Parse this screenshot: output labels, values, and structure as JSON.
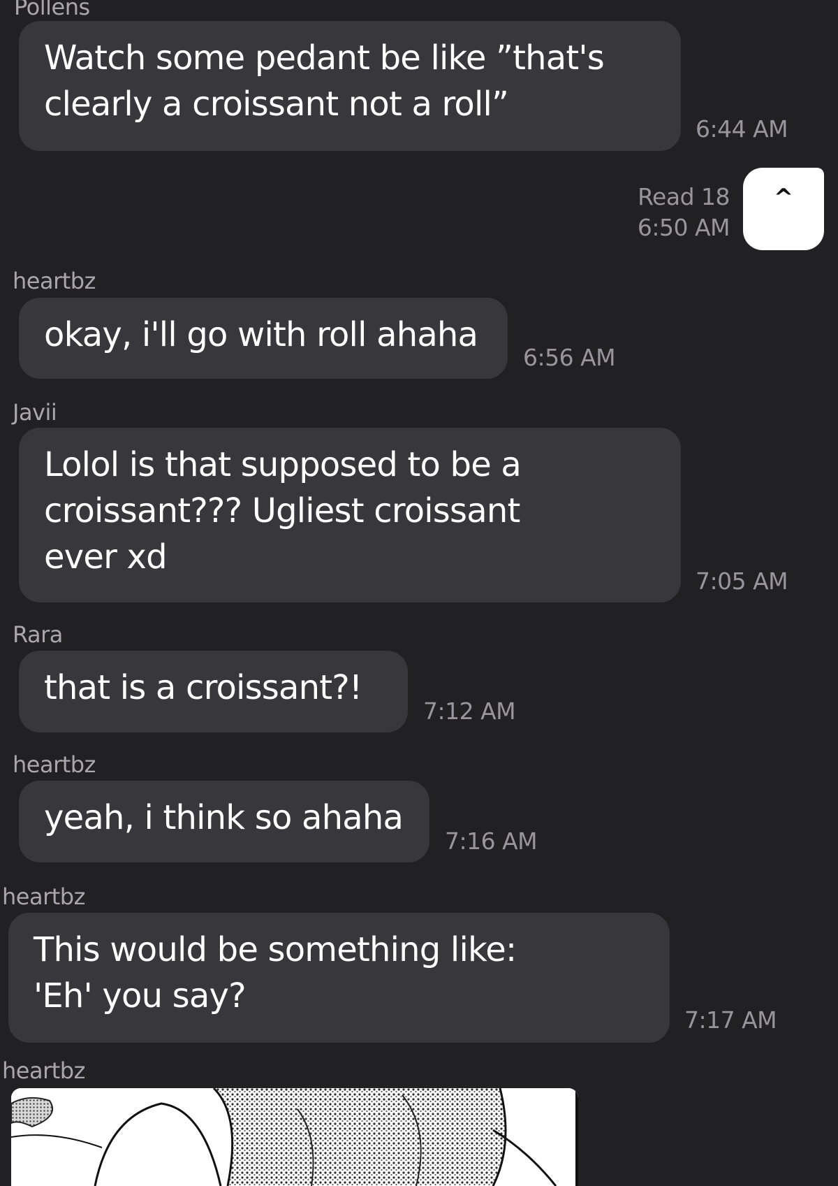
{
  "messages": [
    {
      "sender": "Pollens",
      "text": "Watch some pedant be like ”that's\nclearly a croissant not a roll”",
      "time": "6:44 AM"
    },
    {
      "sender": "heartbz",
      "text": "okay, i'll go with roll ahaha",
      "time": "6:56 AM"
    },
    {
      "sender": "Javii",
      "text": "Lolol is that supposed to be a\ncroissant??? Ugliest croissant\never xd",
      "time": "7:05 AM"
    },
    {
      "sender": "Rara",
      "text": "that is a croissant?!",
      "time": "7:12 AM"
    },
    {
      "sender": "heartbz",
      "text": "yeah, i think so ahaha",
      "time": "7:16 AM"
    },
    {
      "sender": "heartbz",
      "text": "This would be something like:\n'Eh' you say?",
      "time": "7:17 AM"
    }
  ],
  "own_message": {
    "text": "^",
    "read_status": "Read 18",
    "time": "6:50 AM"
  },
  "image_message": {
    "sender": "heartbz",
    "content": "manga-panel-image"
  },
  "colors": {
    "background": "#212023",
    "bubble": "#38373b",
    "own_bubble": "#ffffff",
    "sender_text": "#a9a7ad",
    "time_text": "#98969c"
  }
}
